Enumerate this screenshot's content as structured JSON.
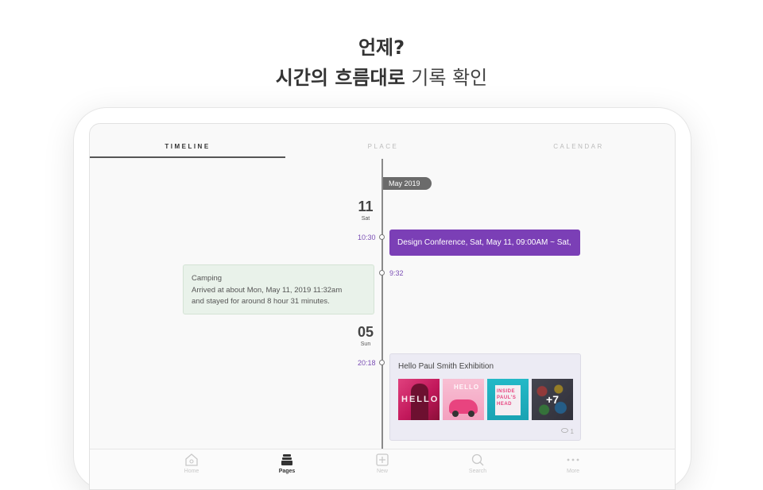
{
  "header": {
    "line1": "언제?",
    "line2_bold": "시간의 흐름대로",
    "line2_light": "기록 확인"
  },
  "tabs": [
    {
      "label": "TIMELINE",
      "active": true
    },
    {
      "label": "PLACE",
      "active": false
    },
    {
      "label": "CALENDAR",
      "active": false
    }
  ],
  "timeline": {
    "month_label": "May 2019",
    "day1": {
      "num": "11",
      "name": "Sat"
    },
    "day2": {
      "num": "05",
      "name": "Sun"
    },
    "event1": {
      "time": "10:30",
      "title": "Design Conference, Sat, May 11, 09:00AM ~ Sat,"
    },
    "event2": {
      "time": "9:32",
      "title": "Camping",
      "line1": "Arrived at about Mon, May 11, 2019 11:32am",
      "line2": "and stayed for around 8 hour 31 minutes."
    },
    "event3": {
      "time": "20:18",
      "title": "Hello Paul Smith Exhibition",
      "more_count": "+7",
      "comment_count": "1",
      "thumb1_text": "HELLO",
      "thumb2_text": "HELLO",
      "thumb3_text": "INSIDE PAUL'S HEAD"
    }
  },
  "nav": [
    {
      "label": "Home",
      "icon": "home-icon",
      "active": false
    },
    {
      "label": "Pages",
      "icon": "pages-icon",
      "active": true
    },
    {
      "label": "New",
      "icon": "plus-square-icon",
      "active": false
    },
    {
      "label": "Search",
      "icon": "search-icon",
      "active": false
    },
    {
      "label": "More",
      "icon": "more-dots-icon",
      "active": false
    }
  ],
  "colors": {
    "accent_purple": "#7b3fb6",
    "time_label": "#7b4fb5",
    "camping_card": "#e9f2ea",
    "gallery_card": "#ecebf4"
  }
}
